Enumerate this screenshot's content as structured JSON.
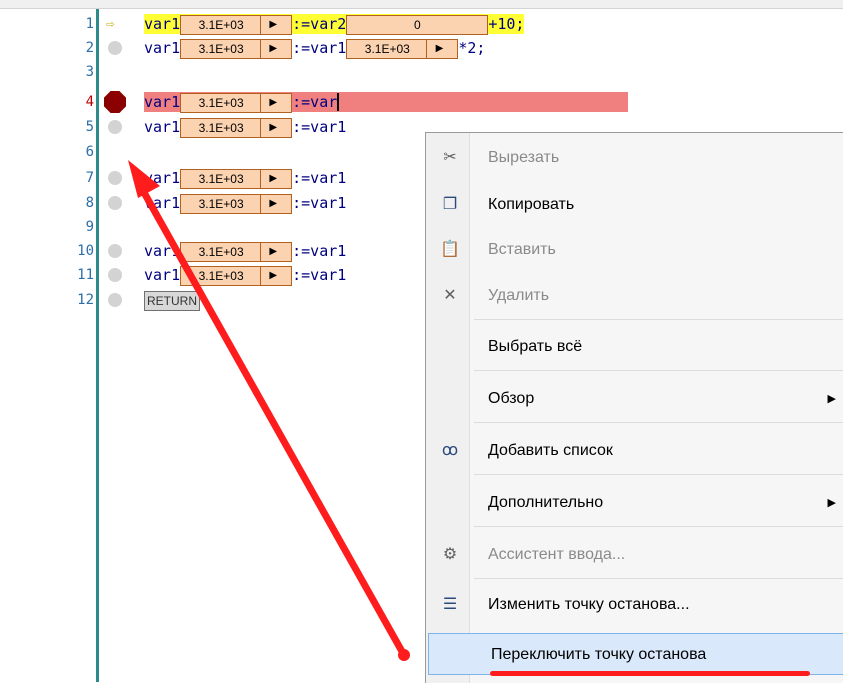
{
  "lines": [
    {
      "num": "1",
      "marker": "current",
      "code": [
        {
          "t": "var1"
        },
        {
          "m": "3.1E+03",
          "w": 110
        },
        {
          "t": ":=var2"
        },
        {
          "m": "0",
          "w": 140,
          "notri": true
        },
        {
          "t": "+10;"
        }
      ]
    },
    {
      "num": "2",
      "marker": "none",
      "code": [
        {
          "t": "var1"
        },
        {
          "m": "3.1E+03",
          "w": 110
        },
        {
          "t": ":=var1"
        },
        {
          "m": "3.1E+03",
          "w": 110
        },
        {
          "t": "*2;"
        }
      ]
    },
    {
      "num": "3",
      "marker": "empty",
      "code": []
    },
    {
      "num": "4",
      "marker": "breakpoint",
      "code": [
        {
          "t": "var1"
        },
        {
          "m": "3.1E+03",
          "w": 110
        },
        {
          "t": ":=var"
        }
      ]
    },
    {
      "num": "5",
      "marker": "none",
      "code": [
        {
          "t": "var1"
        },
        {
          "m": "3.1E+03",
          "w": 110
        },
        {
          "t": ":=var1"
        }
      ]
    },
    {
      "num": "6",
      "marker": "empty",
      "code": []
    },
    {
      "num": "7",
      "marker": "none",
      "code": [
        {
          "t": "var1"
        },
        {
          "m": "3.1E+03",
          "w": 110
        },
        {
          "t": ":=var1"
        }
      ]
    },
    {
      "num": "8",
      "marker": "none",
      "code": [
        {
          "t": "var1"
        },
        {
          "m": "3.1E+03",
          "w": 110
        },
        {
          "t": ":=var1"
        }
      ]
    },
    {
      "num": "9",
      "marker": "empty",
      "code": []
    },
    {
      "num": "10",
      "marker": "none",
      "code": [
        {
          "t": "var1"
        },
        {
          "m": "3.1E+03",
          "w": 110
        },
        {
          "t": ":=var1"
        }
      ]
    },
    {
      "num": "11",
      "marker": "none",
      "code": [
        {
          "t": "var1"
        },
        {
          "m": "3.1E+03",
          "w": 110
        },
        {
          "t": ":=var1"
        }
      ]
    },
    {
      "num": "12",
      "marker": "none",
      "code": [
        {
          "ret": "RETURN"
        }
      ]
    }
  ],
  "menu": {
    "items": [
      {
        "label": "Вырезать",
        "icon": "cut-icon",
        "glyph": "✂",
        "disabled": true,
        "sep_after": false
      },
      {
        "label": "Копировать",
        "icon": "copy-icon",
        "glyph": "❐",
        "disabled": false,
        "sep_after": false
      },
      {
        "label": "Вставить",
        "icon": "paste-icon",
        "glyph": "📋",
        "disabled": true,
        "sep_after": false
      },
      {
        "label": "Удалить",
        "icon": "delete-icon",
        "glyph": "✕",
        "disabled": true,
        "sep_after": true
      },
      {
        "label": "Выбрать всё",
        "icon": "",
        "glyph": "",
        "disabled": false,
        "sep_after": true
      },
      {
        "label": "Обзор",
        "icon": "",
        "glyph": "",
        "disabled": false,
        "submenu": true,
        "sep_after": true
      },
      {
        "label": "Добавить список",
        "icon": "glasses-icon",
        "glyph": "ꝏ",
        "disabled": false,
        "sep_after": true
      },
      {
        "label": "Дополнительно",
        "icon": "",
        "glyph": "",
        "disabled": false,
        "submenu": true,
        "sep_after": true
      },
      {
        "label": "Ассистент ввода...",
        "icon": "input-assistant-icon",
        "glyph": "⚙",
        "disabled": true,
        "sep_after": true
      },
      {
        "label": "Изменить точку останова...",
        "icon": "edit-breakpoint-icon",
        "glyph": "☰",
        "disabled": false,
        "sep_after": false
      },
      {
        "label": "Переключить точку останова",
        "icon": "",
        "glyph": "",
        "disabled": false,
        "selected": true,
        "sep_after": false
      }
    ]
  },
  "colors": {
    "annotation_red": "#ff1c1c",
    "highlight_yellow": "#ffff33",
    "breakpoint_line": "#f08080",
    "breakpoint_marker": "#8b0000",
    "monitor_fill": "#fbd3b0"
  }
}
